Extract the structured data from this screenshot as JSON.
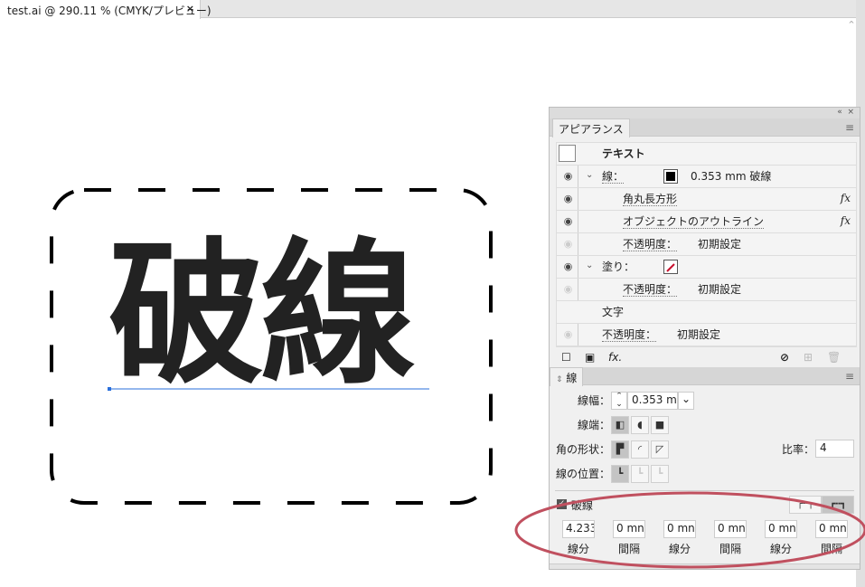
{
  "document_tab": {
    "title": "test.ai @ 290.11 % (CMYK/プレビュー)",
    "close": "×"
  },
  "canvas": {
    "text": "破線"
  },
  "appearance": {
    "tab": "アピアランス",
    "collapse": "«",
    "close": "×",
    "menu": "≡",
    "rows": [
      {
        "label": "テキスト"
      },
      {
        "label": "線：",
        "value": "0.353 mm 破線"
      },
      {
        "label": "角丸長方形",
        "fx": "fx"
      },
      {
        "label": "オブジェクトのアウトライン",
        "fx": "fx"
      },
      {
        "label": "不透明度：",
        "value": "初期設定"
      },
      {
        "label": "塗り："
      },
      {
        "label": "不透明度：",
        "value": "初期設定"
      },
      {
        "label": "文字"
      },
      {
        "label": "不透明度：",
        "value": "初期設定"
      }
    ],
    "footer_fx": "fx."
  },
  "stroke": {
    "tab": "線",
    "menu": "≡",
    "weight_label": "線幅：",
    "weight_value": "0.353 mr",
    "cap_label": "線端：",
    "corner_label": "角の形状：",
    "ratio_label": "比率：",
    "ratio_value": "4",
    "align_label": "線の位置：",
    "dashed_label": "破線",
    "dashed_checked": true,
    "dash_fields": [
      {
        "value": "4.233",
        "label": "線分"
      },
      {
        "value": "0 mn",
        "label": "間隔"
      },
      {
        "value": "0 mn",
        "label": "線分"
      },
      {
        "value": "0 mn",
        "label": "間隔"
      },
      {
        "value": "0 mn",
        "label": "線分"
      },
      {
        "value": "0 mn",
        "label": "間隔"
      }
    ]
  },
  "colors": {
    "highlight_ellipse": "#c0505f",
    "selection": "#2a6fdb"
  }
}
